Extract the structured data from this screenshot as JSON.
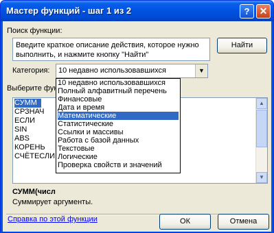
{
  "title": "Мастер функций - шаг 1 из 2",
  "titlebar": {
    "help": "?",
    "close": "✕"
  },
  "search": {
    "label": "Поиск функции:",
    "line1": "Введите краткое описание действия, которое нужно",
    "line2": "выполнить, и нажмите кнопку \"Найти\"",
    "find_button": "Найти"
  },
  "category": {
    "label": "Категория:",
    "selected": "10 недавно использовавшихся",
    "options": [
      "10 недавно использовавшихся",
      "Полный алфавитный перечень",
      "Финансовые",
      "Дата и время",
      "Математические",
      "Статистические",
      "Ссылки и массивы",
      "Работа с базой данных",
      "Текстовые",
      "Логические",
      "Проверка свойств и значений"
    ],
    "highlighted": "Математические"
  },
  "functions": {
    "label": "Выберите фун",
    "items": [
      "СУММ",
      "СРЗНАЧ",
      "ЕСЛИ",
      "SIN",
      "ABS",
      "КОРЕНЬ",
      "СЧЁТЕСЛИ"
    ],
    "selected": "СУММ"
  },
  "signature": "СУММ(числ",
  "description": "Суммирует аргументы.",
  "help_link": "Справка по этой функции",
  "ok": "ОК",
  "cancel": "Отмена"
}
